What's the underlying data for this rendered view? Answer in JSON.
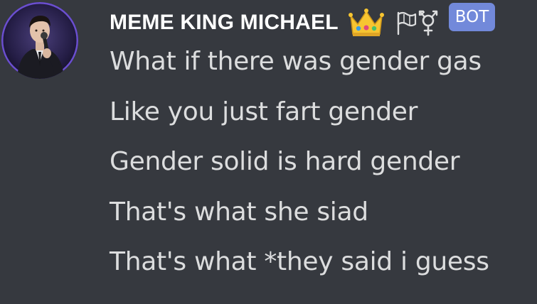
{
  "message": {
    "author": {
      "username": "MEME KING MICHAEL",
      "badges": [
        "crown-icon",
        "flag-icon",
        "transgender-symbol-icon"
      ],
      "tag": "BOT"
    },
    "lines": [
      "What if there was gender gas",
      "Like you just fart gender",
      "Gender solid is hard gender",
      "That's what she siad",
      "That's what *they said i guess"
    ]
  },
  "colors": {
    "background": "#36393f",
    "username": "#ffffff",
    "message_text": "#dcddde",
    "bot_tag": "#7289da"
  }
}
